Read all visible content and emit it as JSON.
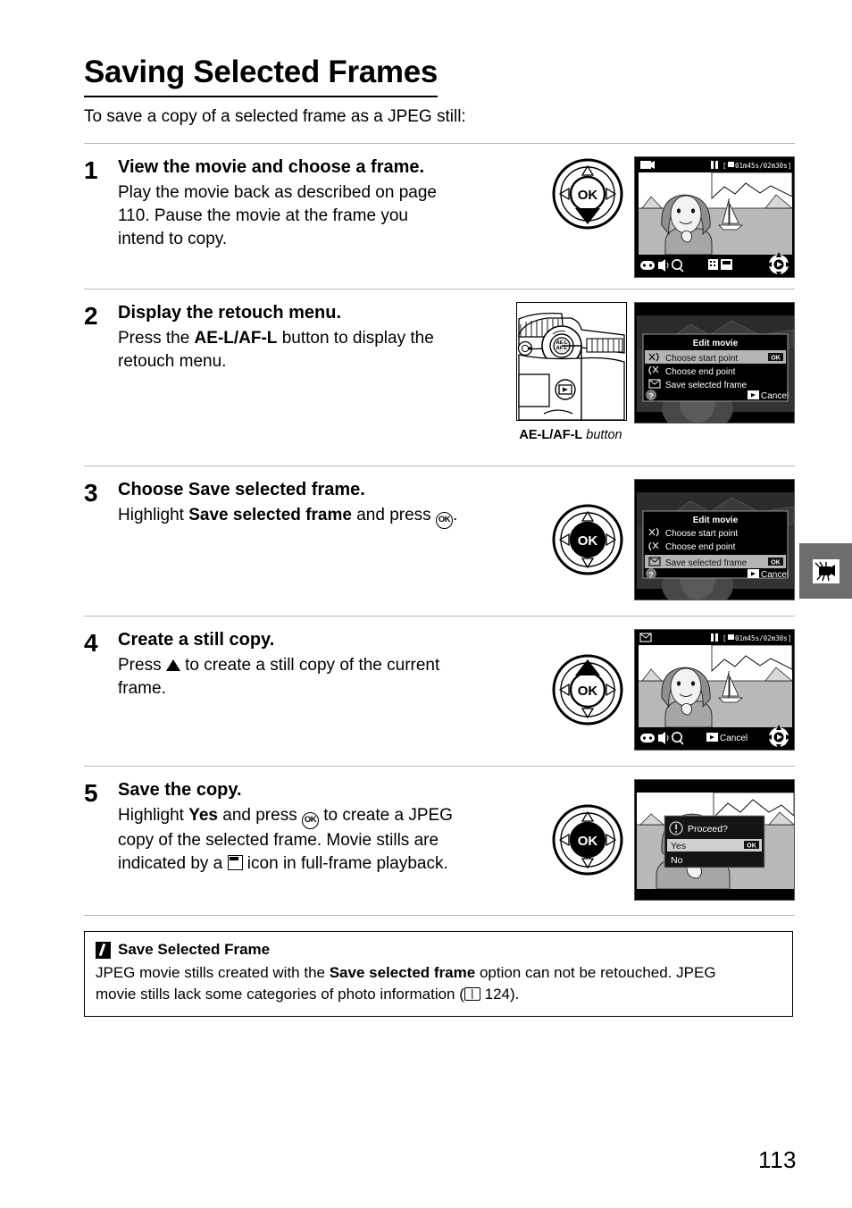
{
  "header": {
    "title": "Saving Selected Frames",
    "intro": "To save a copy of a selected frame as a JPEG still:"
  },
  "steps": [
    {
      "number": "1",
      "heading": "View the movie and choose a frame.",
      "body_1": "Play the movie back as described on page",
      "body_2": "110.  Pause the movie at the frame you",
      "body_3": "intend to copy.",
      "selector_state": "down-pressed",
      "screen": {
        "kind": "movie-playback",
        "top_left_icon": "movie-icon",
        "pause_icon": "pause-icon",
        "timecode": "01m45s/02m30s",
        "bottom_left_icons": "zoom-out-icon, volume-icon, zoom-in-icon",
        "bottom_center_label": "",
        "bottom_center_icons": "edit-movie-icon",
        "bottom_right_icon": "multi-selector-icon"
      }
    },
    {
      "number": "2",
      "heading": "Display the retouch menu.",
      "body_pre": "Press the ",
      "body_bold": "AE-L/AF-L",
      "body_post": " button to display the",
      "body_2": "retouch menu.",
      "camera_caption_bold": "AE-L/AF-L",
      "camera_caption_italic": " button",
      "screen": {
        "kind": "edit-movie-menu",
        "menu_title": "Edit movie",
        "items": [
          {
            "label": "Choose start point",
            "icon": "start-point-icon",
            "selected": true,
            "badge": "OK"
          },
          {
            "label": "Choose end point",
            "icon": "end-point-icon",
            "selected": false,
            "badge": ""
          },
          {
            "label": "Save selected frame",
            "icon": "save-frame-icon",
            "selected": false,
            "badge": ""
          }
        ],
        "help_icon": "question-mark-icon",
        "cancel_label": "Cancel",
        "cancel_icon": "playback-button-icon"
      }
    },
    {
      "number": "3",
      "heading_pre": "Choose ",
      "heading_bold": "Save selected frame",
      "heading_post": ".",
      "body_pre": "Highlight ",
      "body_bold": "Save selected frame",
      "body_post": " and press ",
      "body_end": ".",
      "selector_state": "ok-pressed",
      "screen": {
        "kind": "edit-movie-menu",
        "menu_title": "Edit movie",
        "items": [
          {
            "label": "Choose start point",
            "icon": "start-point-icon",
            "selected": false,
            "badge": ""
          },
          {
            "label": "Choose end point",
            "icon": "end-point-icon",
            "selected": false,
            "badge": ""
          },
          {
            "label": "Save selected frame",
            "icon": "save-frame-icon",
            "selected": true,
            "badge": "OK"
          }
        ],
        "help_icon": "question-mark-icon",
        "cancel_label": "Cancel",
        "cancel_icon": "playback-button-icon"
      }
    },
    {
      "number": "4",
      "heading": "Create a still copy.",
      "body_pre": "Press ",
      "body_post": " to create a still copy of the current",
      "body_2": "frame.",
      "selector_state": "up-pressed",
      "screen": {
        "kind": "movie-playback",
        "top_left_icon": "save-frame-icon",
        "pause_icon": "pause-icon",
        "timecode": "01m45s/02m30s",
        "bottom_left_icons": "zoom-out-icon, volume-icon, zoom-in-icon",
        "bottom_center_label": "Cancel",
        "bottom_center_icons": "playback-button-icon",
        "bottom_right_icon": "multi-selector-icon"
      }
    },
    {
      "number": "5",
      "heading": "Save the copy.",
      "body_pre": "Highlight ",
      "body_bold": "Yes",
      "body_mid": " and press ",
      "body_post": " to create a JPEG",
      "body_2": "copy of the selected frame.  Movie stills are",
      "body_3_pre": "indicated by a ",
      "body_3_post": " icon in full-frame playback.",
      "selector_state": "ok-pressed",
      "screen": {
        "kind": "proceed-dialog",
        "dialog_title": "Proceed?",
        "dialog_icon": "exclamation-icon",
        "options": [
          {
            "label": "Yes",
            "selected": true,
            "badge": "OK"
          },
          {
            "label": "No",
            "selected": false,
            "badge": ""
          }
        ]
      }
    }
  ],
  "note": {
    "icon": "pencil-icon",
    "title": "Save Selected Frame",
    "line1_pre": "JPEG movie stills created with the ",
    "line1_bold": "Save selected frame",
    "line1_post": " option can not be retouched.  JPEG",
    "line2_pre": "movie stills lack some categories of photo information (",
    "line2_page": " 124).",
    "reference_page": "124"
  },
  "side_tab": {
    "icon": "movie-camera-icon"
  },
  "footer": {
    "page_number": "113"
  },
  "colors": {
    "tab_gray": "#6d6d6d",
    "rule_gray": "#b9b9b9",
    "lcd_black": "#000000",
    "menu_gray": "#b4b4b4",
    "text": "#000000"
  }
}
